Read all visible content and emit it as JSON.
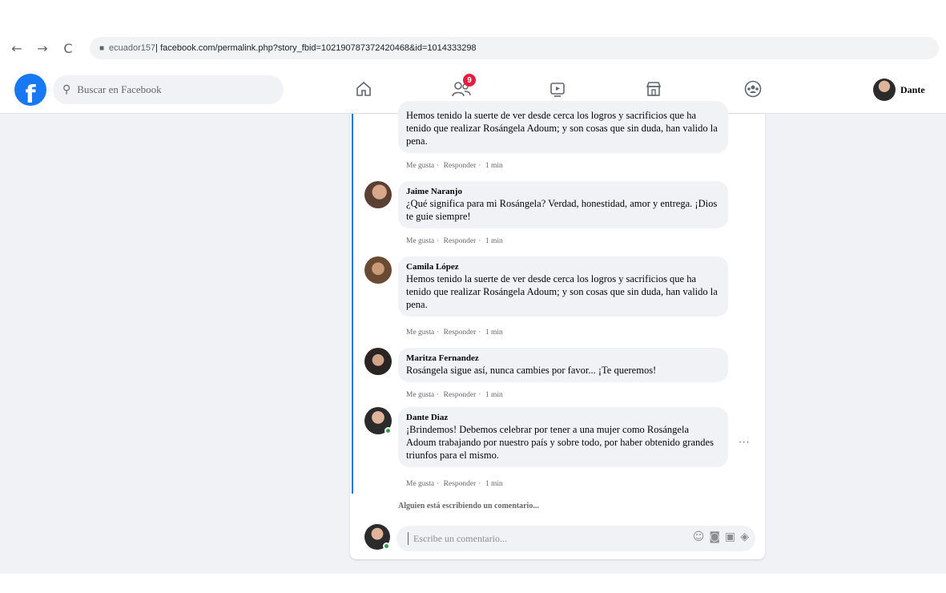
{
  "browser": {
    "back": "←",
    "forward": "→",
    "reload": "C",
    "url_host": "ecuador157",
    "url_rest": " | facebook.com/permalink.php?story_fbid=102190787372420468&id=1014333298"
  },
  "header": {
    "logo": "f",
    "search_placeholder": "Buscar en Facebook",
    "nav_icons": [
      "home-icon",
      "friends-icon",
      "watch-icon",
      "marketplace-icon",
      "groups-icon"
    ],
    "friends_badge": "9",
    "profile_name": "Dante"
  },
  "comments": [
    {
      "author": "",
      "text": "Hemos tenido la suerte de ver desde cerca los logros y sacrificios que ha tenido que realizar Rosángela Adoum; y son cosas que sin duda, han valido la pena.",
      "like": "Me gusta",
      "reply": "Responder",
      "time": "1 min"
    },
    {
      "author": "Jaime Naranjo",
      "text": "¿Qué significa para mi Rosángela? Verdad, honestidad, amor y entrega. ¡Dios te guie siempre!",
      "like": "Me gusta",
      "reply": "Responder",
      "time": "1 min"
    },
    {
      "author": "Camila López",
      "text": "Hemos tenido la suerte de ver desde cerca los logros y sacrificios que ha tenido que realizar Rosángela Adoum; y son cosas que sin duda, han valido la pena.",
      "like": "Me gusta",
      "reply": "Responder",
      "time": "1 min"
    },
    {
      "author": "Maritza Fernandez",
      "text": "Rosángela sigue así, nunca cambies por favor... ¡Te queremos!",
      "like": "Me gusta",
      "reply": "Responder",
      "time": "1 min"
    },
    {
      "author": "Dante Diaz",
      "text": "¡Brindemos! Debemos celebrar por tener a una mujer como Rosángela Adoum trabajando por nuestro país y sobre todo, por haber obtenido grandes triunfos para el mismo.",
      "like": "Me gusta",
      "reply": "Responder",
      "time": "1 min"
    }
  ],
  "more_options": "···",
  "typing_status": "Alguien está escribiendo un comentario...",
  "composer": {
    "placeholder": "Escribe un comentario...",
    "icons": [
      "emoji-icon",
      "camera-icon",
      "gif-icon",
      "sticker-icon"
    ]
  },
  "colors": {
    "facebook_blue": "#1877f2",
    "thread_line": "#1b74e4",
    "badge_red": "#e41e3f",
    "background": "#f0f2f5"
  }
}
